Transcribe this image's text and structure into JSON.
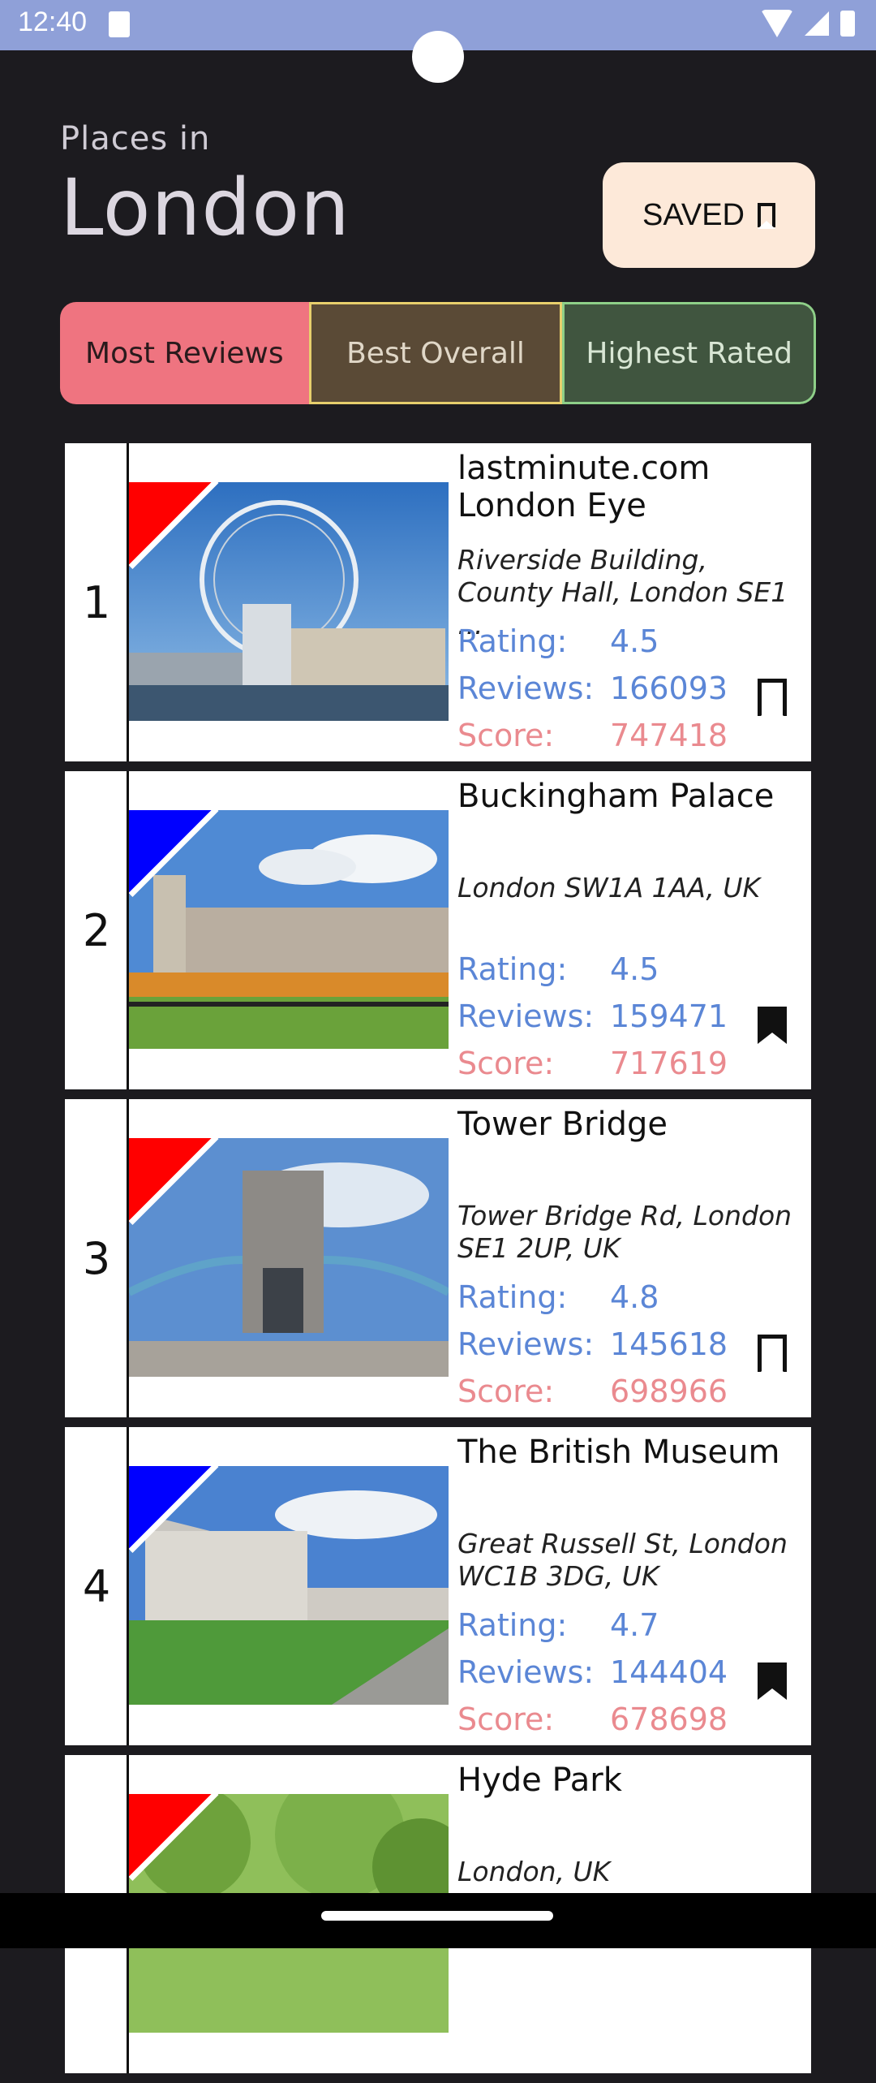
{
  "status": {
    "time": "12:40"
  },
  "header": {
    "subtitle": "Places in",
    "title": "London",
    "saved_label": "SAVED"
  },
  "tabs": [
    {
      "label": "Most Reviews"
    },
    {
      "label": "Best Overall"
    },
    {
      "label": "Highest Rated"
    }
  ],
  "labels": {
    "rating": "Rating:",
    "reviews": "Reviews:",
    "score": "Score:"
  },
  "places": [
    {
      "rank": "1",
      "name": "lastminute.com London Eye",
      "address": "Riverside Building, County Hall, London SE1 ...",
      "rating": "4.5",
      "reviews": "166093",
      "score": "747418",
      "saved": false,
      "flag_color": "#ff0000"
    },
    {
      "rank": "2",
      "name": "Buckingham Palace",
      "address": "London SW1A 1AA, UK",
      "rating": "4.5",
      "reviews": "159471",
      "score": "717619",
      "saved": true,
      "flag_color": "#0000ff"
    },
    {
      "rank": "3",
      "name": "Tower Bridge",
      "address": "Tower Bridge Rd, London SE1 2UP, UK",
      "rating": "4.8",
      "reviews": "145618",
      "score": "698966",
      "saved": false,
      "flag_color": "#ff0000"
    },
    {
      "rank": "4",
      "name": "The British Museum",
      "address": "Great Russell St, London WC1B 3DG, UK",
      "rating": "4.7",
      "reviews": "144404",
      "score": "678698",
      "saved": true,
      "flag_color": "#0000ff"
    },
    {
      "rank": "",
      "name": "Hyde Park",
      "address": "London, UK",
      "rating": "",
      "reviews": "",
      "score": "",
      "saved": false,
      "flag_color": "#ff0000"
    }
  ]
}
